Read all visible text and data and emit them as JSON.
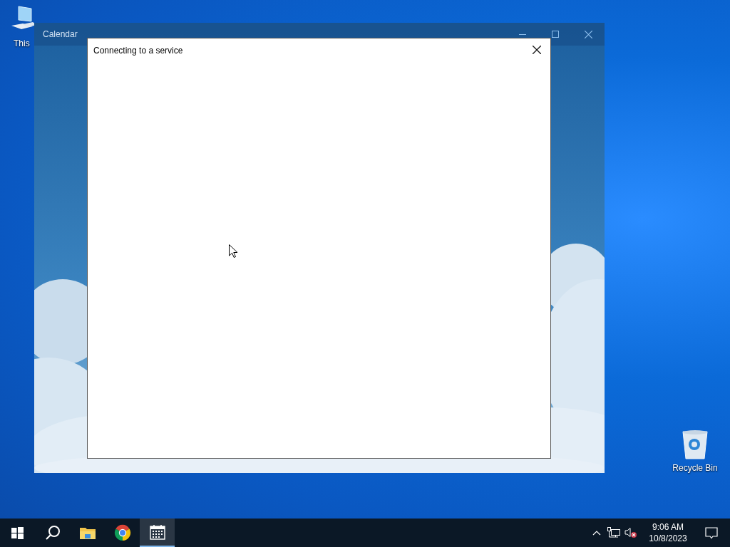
{
  "desktop_icons": [
    {
      "kind": "computer",
      "label": "This"
    },
    {
      "kind": "recycle",
      "label": "Recycle Bin"
    }
  ],
  "window": {
    "title": "Calendar"
  },
  "dialog": {
    "title": "Connecting to a service"
  },
  "taskbar": {
    "apps": [
      {
        "kind": "start",
        "selected": false
      },
      {
        "kind": "search",
        "selected": false
      },
      {
        "kind": "folder",
        "selected": false
      },
      {
        "kind": "chrome",
        "selected": false
      },
      {
        "kind": "calendar",
        "selected": true
      }
    ],
    "time": "9:06 AM",
    "date": "10/8/2023"
  }
}
